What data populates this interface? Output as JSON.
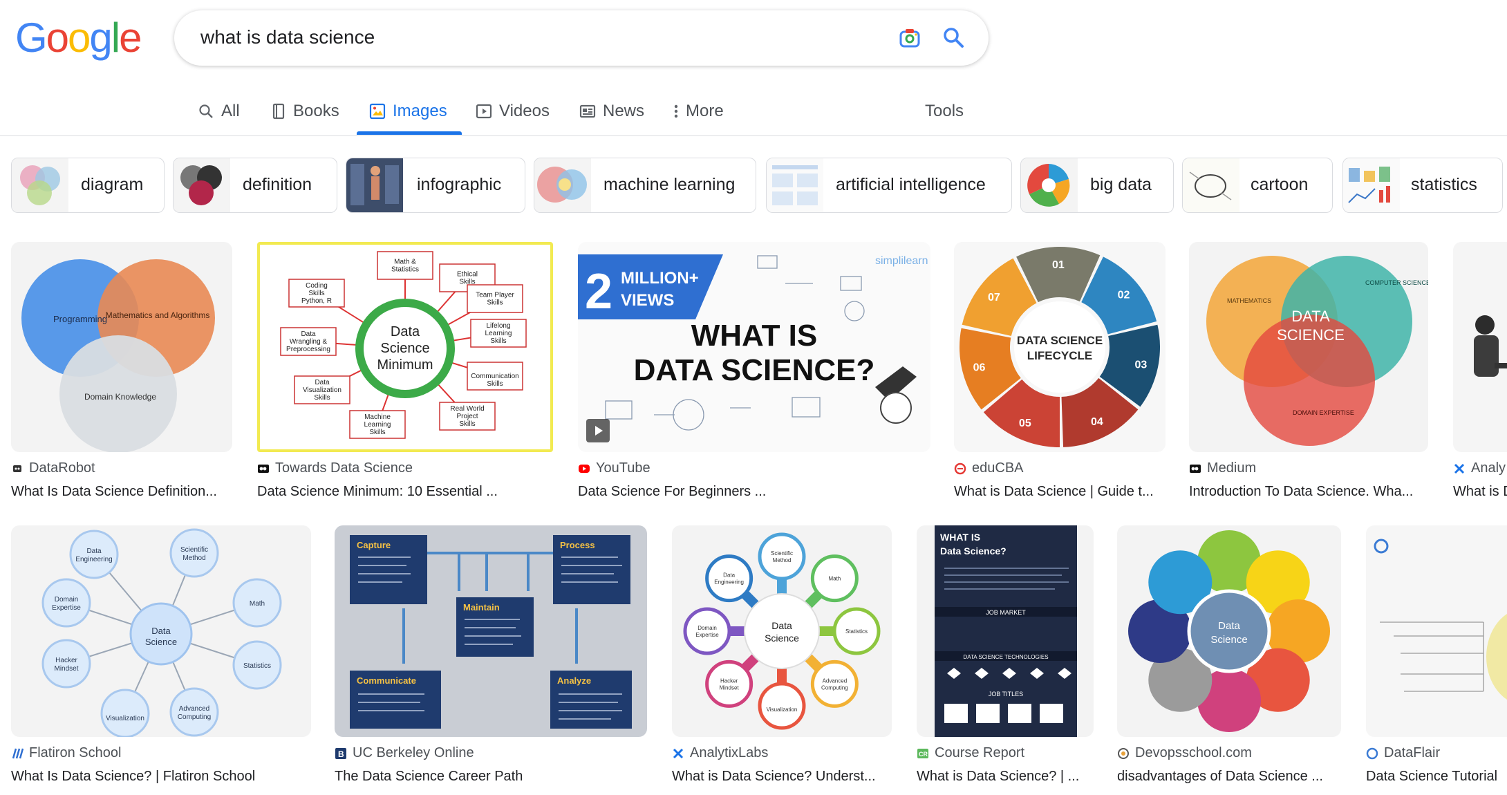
{
  "logo": {
    "g1": "G",
    "o1": "o",
    "o2": "o",
    "g2": "g",
    "l": "l",
    "e": "e"
  },
  "search": {
    "query": "what is data science"
  },
  "tabs": [
    {
      "label": "All",
      "icon": "search-icon"
    },
    {
      "label": "Books",
      "icon": "book-icon"
    },
    {
      "label": "Images",
      "icon": "image-icon"
    },
    {
      "label": "Videos",
      "icon": "play-icon"
    },
    {
      "label": "News",
      "icon": "news-icon"
    },
    {
      "label": "More",
      "icon": "more-vert-icon"
    },
    {
      "label": "Tools",
      "icon": ""
    }
  ],
  "chips": [
    "diagram",
    "definition",
    "infographic",
    "machine learning",
    "artificial intelligence",
    "big data",
    "cartoon",
    "statistics"
  ],
  "results_row1": [
    {
      "source": "DataRobot",
      "title": "What Is Data Science Definition...",
      "img": {
        "c1": "Programming",
        "c2": "Mathematics and Algorithms",
        "c3": "Domain Knowledge"
      }
    },
    {
      "source": "Towards Data Science",
      "title": "Data Science Minimum: 10 Essential ...",
      "img": {
        "center": "Data Science Minimum",
        "items": [
          "Math & Statistics",
          "Ethical Skills",
          "Team Player Skills",
          "Lifelong Learning Skills",
          "Communication Skills",
          "Real World Project Skills",
          "Machine Learning Skills",
          "Data Visualization Skills",
          "Data Wrangling & Preprocessing",
          "Coding Skills Python, R"
        ]
      }
    },
    {
      "source": "YouTube",
      "title": "Data Science For Beginners ...",
      "img": {
        "badge_big": "2",
        "badge_a": "MILLION+",
        "badge_b": "VIEWS",
        "headline1": "WHAT IS",
        "headline2": "DATA SCIENCE?",
        "brand": "simplilearn"
      }
    },
    {
      "source": "eduCBA",
      "title": "What is Data Science | Guide t...",
      "img": {
        "center1": "DATA SCIENCE",
        "center2": "LIFECYCLE",
        "nums": [
          "01",
          "02",
          "03",
          "04",
          "05",
          "06",
          "07"
        ]
      }
    },
    {
      "source": "Medium",
      "title": "Introduction To Data Science. Wha...",
      "img": {
        "center1": "DATA",
        "center2": "SCIENCE",
        "a": "MATHEMATICS",
        "b": "COMPUTER SCIENCE",
        "c": "DOMAIN EXPERTISE"
      }
    },
    {
      "source": "Analy",
      "title": "What is D",
      "img": {}
    }
  ],
  "results_row2": [
    {
      "source": "Flatiron School",
      "title": "What Is Data Science? | Flatiron School",
      "img": {
        "center": "Data Science",
        "items": [
          "Data Engineering",
          "Scientific Method",
          "Math",
          "Statistics",
          "Advanced Computing",
          "Visualization",
          "Hacker Mindset",
          "Domain Expertise"
        ]
      }
    },
    {
      "source": "UC Berkeley Online",
      "title": "The Data Science Career Path",
      "img": {
        "boxes": [
          "Capture",
          "Process",
          "Maintain",
          "Communicate",
          "Analyze"
        ]
      }
    },
    {
      "source": "AnalytixLabs",
      "title": "What is Data Science? Underst...",
      "img": {
        "center": "Data Science",
        "items": [
          "Scientific Method",
          "Math",
          "Statistics",
          "Advanced Computing",
          "Visualization",
          "Hacker Mindset",
          "Domain Expertise",
          "Data Engineering"
        ]
      }
    },
    {
      "source": "Course Report",
      "title": "What is Data Science? | ...",
      "img": {
        "head1": "WHAT IS",
        "head2": "Data Science?",
        "s1": "JOB MARKET",
        "s2": "DATA SCIENCE TECHNOLOGIES",
        "s3": "JOB TITLES"
      }
    },
    {
      "source": "Devopsschool.com",
      "title": "disadvantages of Data Science ...",
      "img": {
        "center": "Data Science"
      }
    },
    {
      "source": "DataFlair",
      "title": "Data Science Tutorial",
      "img": {}
    }
  ],
  "colors": {
    "accent": "#1a73e8",
    "blue": "#4285f4",
    "red": "#ea4335",
    "yellow": "#fbbc05",
    "green": "#34a853"
  }
}
